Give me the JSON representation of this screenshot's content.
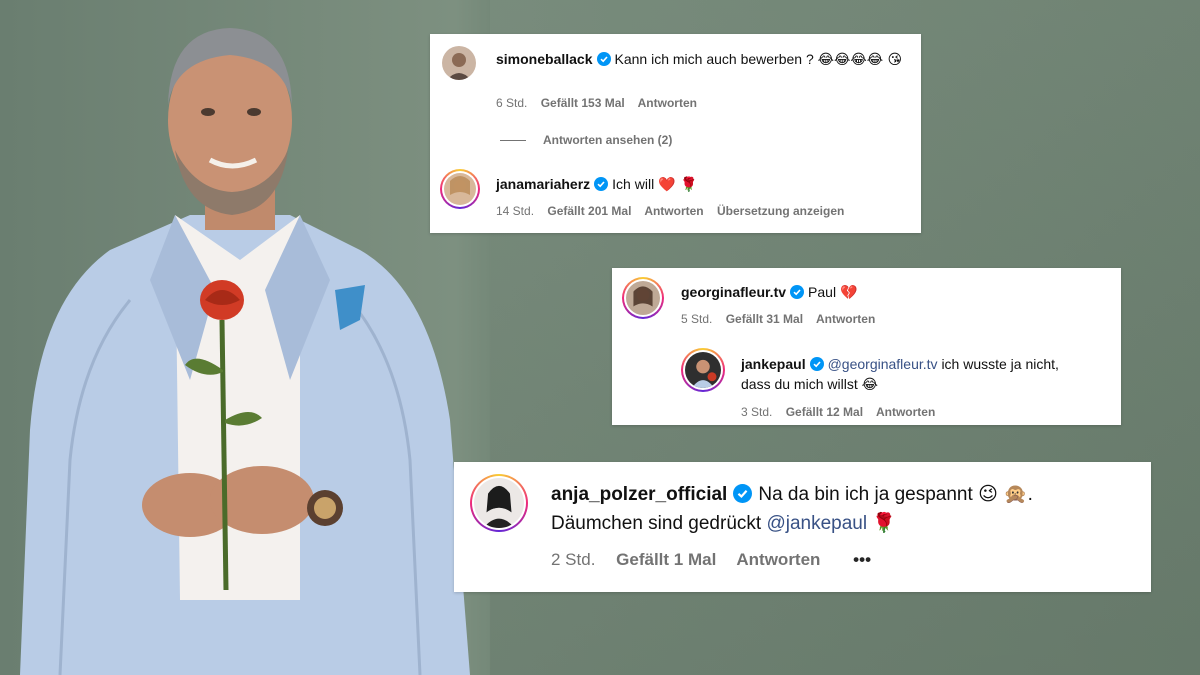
{
  "comments": [
    {
      "username": "simoneballack",
      "text": "Kann ich mich auch bewerben ?",
      "emojis": "😂😂😂😂 😘",
      "time": "6 Std.",
      "likes": "Gefällt 153 Mal",
      "reply": "Antworten",
      "view_replies": "Antworten ansehen (2)"
    },
    {
      "username": "janamariaherz",
      "text": "Ich will",
      "emojis": "❤️ 🌹",
      "time": "14 Std.",
      "likes": "Gefällt 201 Mal",
      "reply": "Antworten",
      "translate": "Übersetzung anzeigen"
    },
    {
      "username": "georginafleur.tv",
      "text": "Paul",
      "emojis": "💔",
      "time": "5 Std.",
      "likes": "Gefällt 31 Mal",
      "reply": "Antworten"
    },
    {
      "username": "jankepaul",
      "mention": "@georginafleur.tv",
      "text_line1": "ich wusste ja nicht,",
      "text_line2": "dass du mich willst",
      "emojis": "😂",
      "time": "3 Std.",
      "likes": "Gefällt 12 Mal",
      "reply": "Antworten"
    },
    {
      "username": "anja_polzer_official",
      "text_line1": "Na da bin ich ja gespannt",
      "emojis_line1": "😉 🙊",
      "text_line1_end": ".",
      "text_line2": "Däumchen sind gedrückt",
      "mention": "@jankepaul",
      "emojis_line2": "🌹",
      "time": "2 Std.",
      "likes": "Gefällt 1 Mal",
      "reply": "Antworten",
      "more": "•••"
    }
  ],
  "colors": {
    "background": "#748878",
    "suit": "#b9cce6",
    "verified": "#0095f6",
    "meta_text": "#737373",
    "mention": "#385185"
  }
}
